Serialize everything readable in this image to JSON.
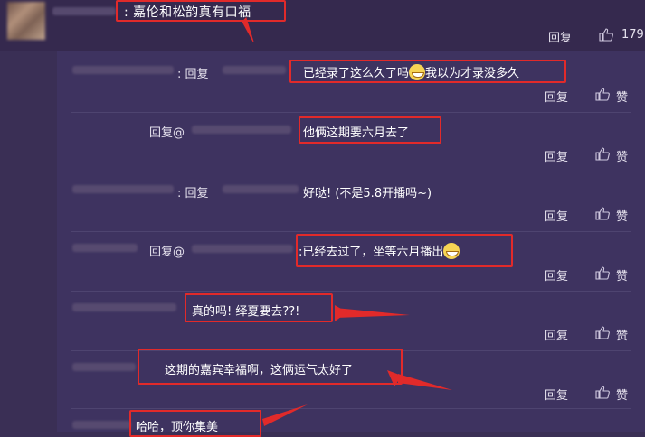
{
  "main": {
    "comment_text": ": 嘉伦和松韵真有口福",
    "reply_label": "回复",
    "like_count": "179"
  },
  "replies": [
    {
      "prefix_colon": ": 回复",
      "text": "已经录了这么久了吗",
      "emoji": "smile-grin",
      "text_after": "我以为才录没多久",
      "reply_label": "回复",
      "like_label": "赞"
    },
    {
      "prefix": "回复@",
      "text": "他俩这期要六月去了",
      "reply_label": "回复",
      "like_label": "赞"
    },
    {
      "prefix_colon": ": 回复",
      "text": "好哒!  (不是5.8开播吗~)",
      "reply_label": "回复",
      "like_label": "赞"
    },
    {
      "prefix": "回复@",
      "text": ":已经去过了，坐等六月播出",
      "emoji": "grin",
      "reply_label": "回复",
      "like_label": "赞"
    },
    {
      "text": "真的吗! 绎夏要去??!",
      "reply_label": "回复",
      "like_label": "赞"
    },
    {
      "text": "这期的嘉宾幸福啊，这俩运气太好了",
      "reply_label": "回复",
      "like_label": "赞"
    },
    {
      "text": "哈哈，顶你集美"
    }
  ],
  "colors": {
    "background": "#3a2f55",
    "panel": "#3e3360",
    "highlight_box": "#e12a2a"
  }
}
